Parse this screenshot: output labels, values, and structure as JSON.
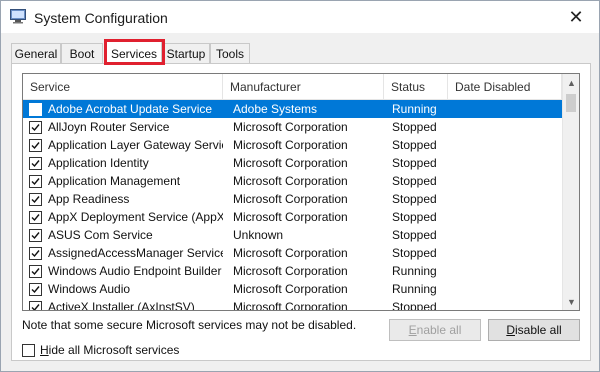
{
  "window": {
    "title": "System Configuration",
    "close_glyph": "✕"
  },
  "tabs": [
    {
      "label": "General"
    },
    {
      "label": "Boot"
    },
    {
      "label": "Services",
      "active": true
    },
    {
      "label": "Startup"
    },
    {
      "label": "Tools"
    }
  ],
  "services_list": {
    "columns": [
      "Service",
      "Manufacturer",
      "Status",
      "Date Disabled"
    ],
    "rows": [
      {
        "checked": true,
        "service": "Adobe Acrobat Update Service",
        "manufacturer": "Adobe Systems",
        "status": "Running",
        "date_disabled": "",
        "selected": true
      },
      {
        "checked": true,
        "service": "AllJoyn Router Service",
        "manufacturer": "Microsoft Corporation",
        "status": "Stopped",
        "date_disabled": ""
      },
      {
        "checked": true,
        "service": "Application Layer Gateway Service",
        "manufacturer": "Microsoft Corporation",
        "status": "Stopped",
        "date_disabled": ""
      },
      {
        "checked": true,
        "service": "Application Identity",
        "manufacturer": "Microsoft Corporation",
        "status": "Stopped",
        "date_disabled": ""
      },
      {
        "checked": true,
        "service": "Application Management",
        "manufacturer": "Microsoft Corporation",
        "status": "Stopped",
        "date_disabled": ""
      },
      {
        "checked": true,
        "service": "App Readiness",
        "manufacturer": "Microsoft Corporation",
        "status": "Stopped",
        "date_disabled": ""
      },
      {
        "checked": true,
        "service": "AppX Deployment Service (AppX...",
        "manufacturer": "Microsoft Corporation",
        "status": "Stopped",
        "date_disabled": ""
      },
      {
        "checked": true,
        "service": "ASUS Com Service",
        "manufacturer": "Unknown",
        "status": "Stopped",
        "date_disabled": ""
      },
      {
        "checked": true,
        "service": "AssignedAccessManager Service",
        "manufacturer": "Microsoft Corporation",
        "status": "Stopped",
        "date_disabled": ""
      },
      {
        "checked": true,
        "service": "Windows Audio Endpoint Builder",
        "manufacturer": "Microsoft Corporation",
        "status": "Running",
        "date_disabled": ""
      },
      {
        "checked": true,
        "service": "Windows Audio",
        "manufacturer": "Microsoft Corporation",
        "status": "Running",
        "date_disabled": ""
      },
      {
        "checked": true,
        "service": "ActiveX Installer (AxInstSV)",
        "manufacturer": "Microsoft Corporation",
        "status": "Stopped",
        "date_disabled": ""
      }
    ]
  },
  "note": "Note that some secure Microsoft services may not be disabled.",
  "buttons": {
    "enable_all": {
      "prefix": "",
      "mnemonic": "E",
      "rest": "nable all",
      "disabled": true
    },
    "disable_all": {
      "prefix": "",
      "mnemonic": "D",
      "rest": "isable all",
      "disabled": false
    }
  },
  "hide_ms": {
    "mnemonic": "H",
    "rest": "ide all Microsoft services",
    "checked": false
  },
  "colors": {
    "selection": "#0078d7",
    "highlight_box": "#e0202f"
  },
  "icons": {
    "app": "system-config-icon",
    "close": "close-icon",
    "check": "checkmark-icon",
    "scroll_up": "scroll-up-icon",
    "scroll_down": "scroll-down-icon"
  }
}
